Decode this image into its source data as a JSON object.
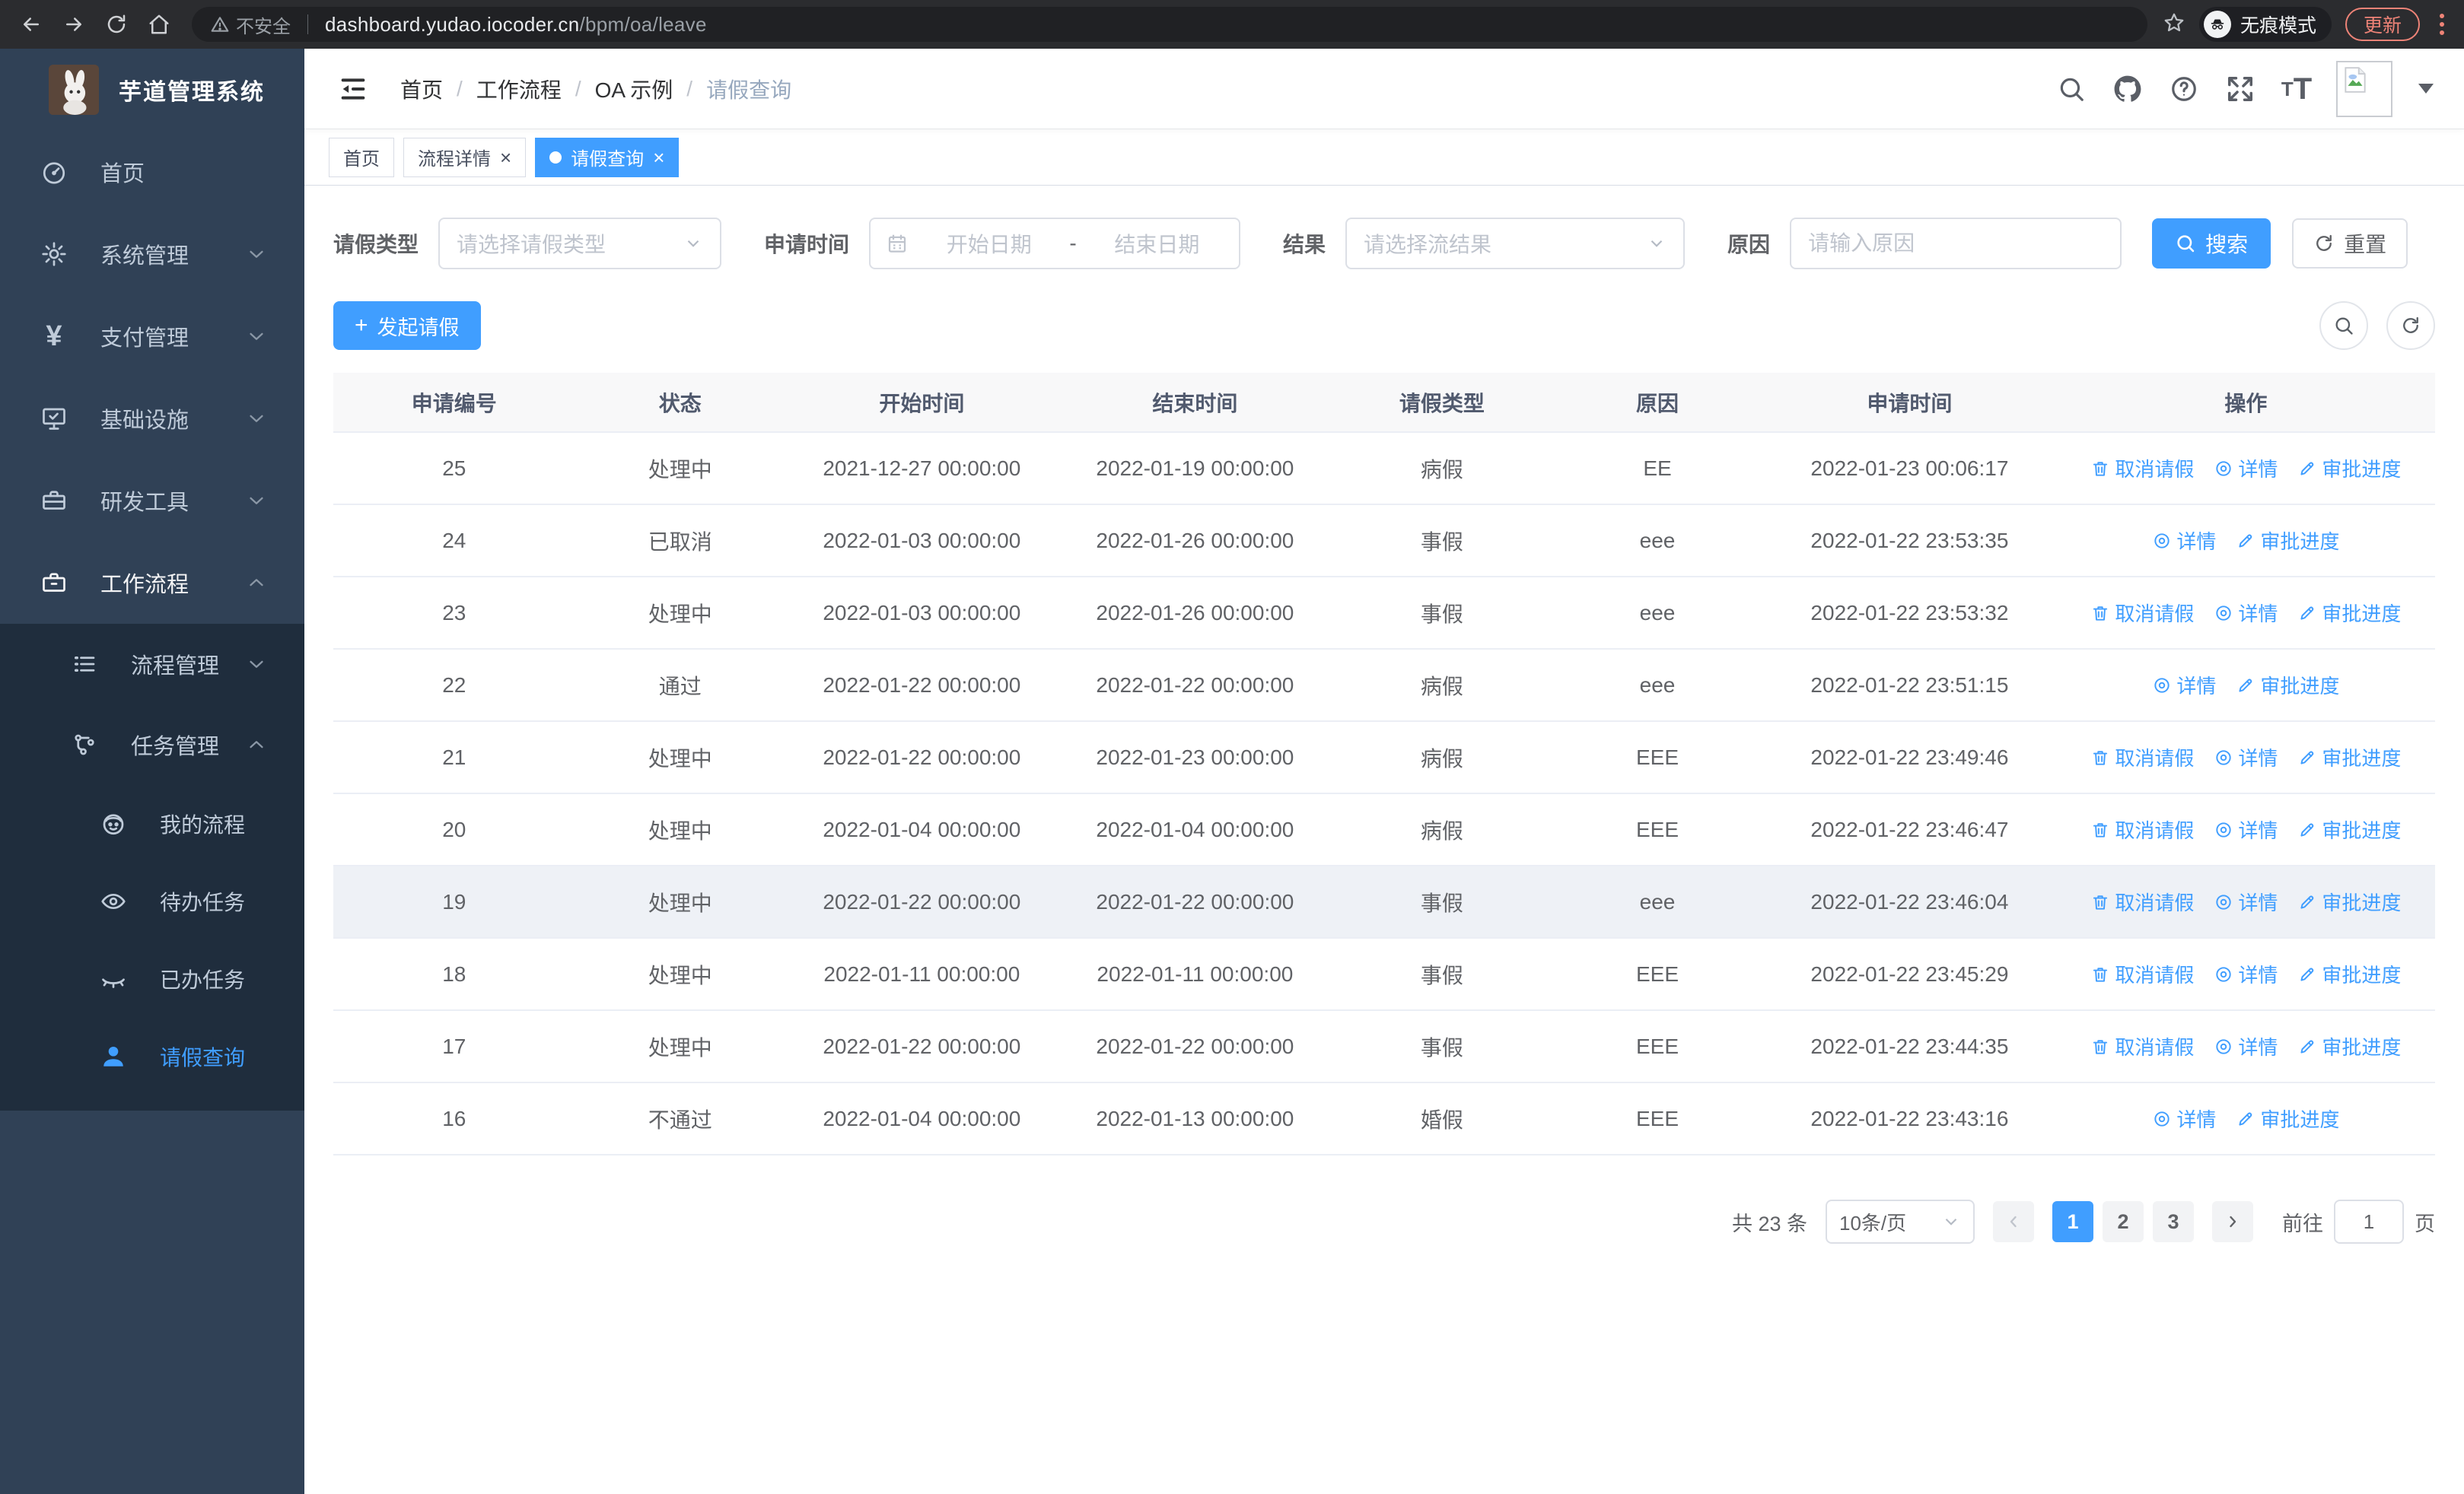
{
  "browser": {
    "security_label": "不安全",
    "url_host": "dashboard.yudao.iocoder.cn",
    "url_path": "/bpm/oa/leave",
    "incognito_label": "无痕模式",
    "update_label": "更新"
  },
  "sidebar": {
    "app_title": "芋道管理系统",
    "menu": [
      {
        "key": "home",
        "label": "首页",
        "icon": "dashboard-icon",
        "level": 1,
        "arrow": null,
        "group": "root"
      },
      {
        "key": "system",
        "label": "系统管理",
        "icon": "gear-icon",
        "level": 1,
        "arrow": "down",
        "group": "root"
      },
      {
        "key": "payment",
        "label": "支付管理",
        "icon": "yen-icon",
        "level": 1,
        "arrow": "down",
        "group": "root"
      },
      {
        "key": "infra",
        "label": "基础设施",
        "icon": "monitor-icon",
        "level": 1,
        "arrow": "down",
        "group": "root"
      },
      {
        "key": "devtools",
        "label": "研发工具",
        "icon": "toolbox-icon",
        "level": 1,
        "arrow": "down",
        "group": "root"
      },
      {
        "key": "workflow",
        "label": "工作流程",
        "icon": "briefcase-icon",
        "level": 1,
        "arrow": "up",
        "group": "root",
        "open": true
      },
      {
        "key": "process-mgmt",
        "label": "流程管理",
        "icon": "list-icon",
        "level": 2,
        "arrow": "down",
        "group": "sub"
      },
      {
        "key": "task-mgmt",
        "label": "任务管理",
        "icon": "share-icon",
        "level": 2,
        "arrow": "up",
        "group": "sub"
      },
      {
        "key": "my-process",
        "label": "我的流程",
        "icon": "face-icon",
        "level": 3,
        "arrow": null,
        "group": "sub"
      },
      {
        "key": "todo-task",
        "label": "待办任务",
        "icon": "eye-icon",
        "level": 3,
        "arrow": null,
        "group": "sub"
      },
      {
        "key": "done-task",
        "label": "已办任务",
        "icon": "eye-closed-icon",
        "level": 3,
        "arrow": null,
        "group": "sub"
      },
      {
        "key": "leave-query",
        "label": "请假查询",
        "icon": "user-icon",
        "level": 3,
        "arrow": null,
        "group": "sub",
        "active": true
      }
    ]
  },
  "breadcrumb": [
    "首页",
    "工作流程",
    "OA 示例",
    "请假查询"
  ],
  "tabs": [
    {
      "label": "首页",
      "closable": false,
      "active": false
    },
    {
      "label": "流程详情",
      "closable": true,
      "active": false
    },
    {
      "label": "请假查询",
      "closable": true,
      "active": true
    }
  ],
  "filters": {
    "leave_type": {
      "label": "请假类型",
      "placeholder": "请选择请假类型"
    },
    "apply_time": {
      "label": "申请时间",
      "start_placeholder": "开始日期",
      "separator": "-",
      "end_placeholder": "结束日期"
    },
    "result": {
      "label": "结果",
      "placeholder": "请选择流结果"
    },
    "reason": {
      "label": "原因",
      "placeholder": "请输入原因"
    },
    "search_label": "搜索",
    "reset_label": "重置"
  },
  "toolbar": {
    "create_label": "发起请假"
  },
  "table": {
    "columns": [
      "申请编号",
      "状态",
      "开始时间",
      "结束时间",
      "请假类型",
      "原因",
      "申请时间",
      "操作"
    ],
    "action_labels": {
      "cancel": "取消请假",
      "detail": "详情",
      "progress": "审批进度"
    },
    "rows": [
      {
        "id": "25",
        "status": "处理中",
        "start": "2021-12-27 00:00:00",
        "end": "2022-01-19 00:00:00",
        "type": "病假",
        "reason": "EE",
        "apply_time": "2022-01-23 00:06:17",
        "actions": [
          "cancel",
          "detail",
          "progress"
        ],
        "hovered": false
      },
      {
        "id": "24",
        "status": "已取消",
        "start": "2022-01-03 00:00:00",
        "end": "2022-01-26 00:00:00",
        "type": "事假",
        "reason": "eee",
        "apply_time": "2022-01-22 23:53:35",
        "actions": [
          "detail",
          "progress"
        ],
        "hovered": false
      },
      {
        "id": "23",
        "status": "处理中",
        "start": "2022-01-03 00:00:00",
        "end": "2022-01-26 00:00:00",
        "type": "事假",
        "reason": "eee",
        "apply_time": "2022-01-22 23:53:32",
        "actions": [
          "cancel",
          "detail",
          "progress"
        ],
        "hovered": false
      },
      {
        "id": "22",
        "status": "通过",
        "start": "2022-01-22 00:00:00",
        "end": "2022-01-22 00:00:00",
        "type": "病假",
        "reason": "eee",
        "apply_time": "2022-01-22 23:51:15",
        "actions": [
          "detail",
          "progress"
        ],
        "hovered": false
      },
      {
        "id": "21",
        "status": "处理中",
        "start": "2022-01-22 00:00:00",
        "end": "2022-01-23 00:00:00",
        "type": "病假",
        "reason": "EEE",
        "apply_time": "2022-01-22 23:49:46",
        "actions": [
          "cancel",
          "detail",
          "progress"
        ],
        "hovered": false
      },
      {
        "id": "20",
        "status": "处理中",
        "start": "2022-01-04 00:00:00",
        "end": "2022-01-04 00:00:00",
        "type": "病假",
        "reason": "EEE",
        "apply_time": "2022-01-22 23:46:47",
        "actions": [
          "cancel",
          "detail",
          "progress"
        ],
        "hovered": false
      },
      {
        "id": "19",
        "status": "处理中",
        "start": "2022-01-22 00:00:00",
        "end": "2022-01-22 00:00:00",
        "type": "事假",
        "reason": "eee",
        "apply_time": "2022-01-22 23:46:04",
        "actions": [
          "cancel",
          "detail",
          "progress"
        ],
        "hovered": true
      },
      {
        "id": "18",
        "status": "处理中",
        "start": "2022-01-11 00:00:00",
        "end": "2022-01-11 00:00:00",
        "type": "事假",
        "reason": "EEE",
        "apply_time": "2022-01-22 23:45:29",
        "actions": [
          "cancel",
          "detail",
          "progress"
        ],
        "hovered": false
      },
      {
        "id": "17",
        "status": "处理中",
        "start": "2022-01-22 00:00:00",
        "end": "2022-01-22 00:00:00",
        "type": "事假",
        "reason": "EEE",
        "apply_time": "2022-01-22 23:44:35",
        "actions": [
          "cancel",
          "detail",
          "progress"
        ],
        "hovered": false
      },
      {
        "id": "16",
        "status": "不通过",
        "start": "2022-01-04 00:00:00",
        "end": "2022-01-13 00:00:00",
        "type": "婚假",
        "reason": "EEE",
        "apply_time": "2022-01-22 23:43:16",
        "actions": [
          "detail",
          "progress"
        ],
        "hovered": false
      }
    ]
  },
  "pagination": {
    "total_label": "共 23 条",
    "page_size_label": "10条/页",
    "pages": [
      "1",
      "2",
      "3"
    ],
    "active_page": "1",
    "goto_label": "前往",
    "goto_value": "1",
    "page_suffix": "页"
  },
  "colors": {
    "primary": "#409eff",
    "sidebar_bg": "#304156",
    "submenu_bg": "#1f2d3d",
    "update_accent": "#ee8377"
  }
}
